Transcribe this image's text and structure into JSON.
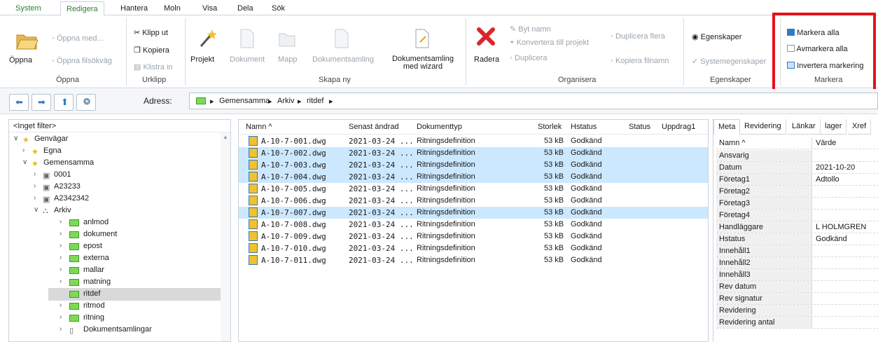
{
  "tabs": [
    "System",
    "Redigera",
    "Hantera",
    "Moln",
    "Visa",
    "Dela",
    "Sök"
  ],
  "ribbon": {
    "oppna": {
      "open": "Öppna",
      "open_with": "Öppna med...",
      "open_path": "Öppna filsökväg",
      "label": "Öppna"
    },
    "urklipp": {
      "cut": "Klipp ut",
      "copy": "Kopiera",
      "paste": "Klistra in",
      "label": "Urklipp"
    },
    "skapa": {
      "project": "Projekt",
      "document": "Dokument",
      "folder": "Mapp",
      "collection": "Dokumentsamling",
      "wizard": "Dokumentsamling med wizard",
      "label": "Skapa ny"
    },
    "organisera": {
      "delete": "Radera",
      "rename": "Byt namn",
      "convert": "Konvertera till projekt",
      "duplicate": "Duplicera",
      "duplicate_many": "Duplicera flera",
      "copy_names": "Kopiera filnamn",
      "label": "Organisera"
    },
    "egenskaper": {
      "props": "Egenskaper",
      "sysprops": "Systemegenskaper",
      "label": "Egenskaper"
    },
    "markera": {
      "select_all": "Markera alla",
      "deselect_all": "Avmarkera alla",
      "invert": "Invertera markering",
      "label": "Markera"
    }
  },
  "address": {
    "label": "Adress:",
    "crumbs": [
      "Gemensamma",
      "Arkiv",
      "ritdef"
    ]
  },
  "tree": {
    "filter": "<Inget filter>",
    "nodes": [
      "Genvägar",
      "Egna",
      "Gemensamma",
      "0001",
      "A23233",
      "A2342342",
      "Arkiv",
      "anlmod",
      "dokument",
      "epost",
      "externa",
      "mallar",
      "matning",
      "ritdef",
      "ritmod",
      "ritning",
      "Dokumentsamlingar"
    ]
  },
  "files": {
    "columns": [
      "Namn",
      "Senast ändrad",
      "Dokumenttyp",
      "Storlek",
      "Hstatus",
      "Status",
      "Uppdrag1"
    ],
    "rows": [
      {
        "name": "A-10-7-001.dwg",
        "date": "2021-03-24 ...",
        "type": "Ritningsdefinition",
        "size": "53 kB",
        "hstatus": "Godkänd",
        "selected": false
      },
      {
        "name": "A-10-7-002.dwg",
        "date": "2021-03-24 ...",
        "type": "Ritningsdefinition",
        "size": "53 kB",
        "hstatus": "Godkänd",
        "selected": true
      },
      {
        "name": "A-10-7-003.dwg",
        "date": "2021-03-24 ...",
        "type": "Ritningsdefinition",
        "size": "53 kB",
        "hstatus": "Godkänd",
        "selected": true
      },
      {
        "name": "A-10-7-004.dwg",
        "date": "2021-03-24 ...",
        "type": "Ritningsdefinition",
        "size": "53 kB",
        "hstatus": "Godkänd",
        "selected": true
      },
      {
        "name": "A-10-7-005.dwg",
        "date": "2021-03-24 ...",
        "type": "Ritningsdefinition",
        "size": "53 kB",
        "hstatus": "Godkänd",
        "selected": false
      },
      {
        "name": "A-10-7-006.dwg",
        "date": "2021-03-24 ...",
        "type": "Ritningsdefinition",
        "size": "53 kB",
        "hstatus": "Godkänd",
        "selected": false
      },
      {
        "name": "A-10-7-007.dwg",
        "date": "2021-03-24 ...",
        "type": "Ritningsdefinition",
        "size": "53 kB",
        "hstatus": "Godkänd",
        "selected": true
      },
      {
        "name": "A-10-7-008.dwg",
        "date": "2021-03-24 ...",
        "type": "Ritningsdefinition",
        "size": "53 kB",
        "hstatus": "Godkänd",
        "selected": false
      },
      {
        "name": "A-10-7-009.dwg",
        "date": "2021-03-24 ...",
        "type": "Ritningsdefinition",
        "size": "53 kB",
        "hstatus": "Godkänd",
        "selected": false
      },
      {
        "name": "A-10-7-010.dwg",
        "date": "2021-03-24 ...",
        "type": "Ritningsdefinition",
        "size": "53 kB",
        "hstatus": "Godkänd",
        "selected": false
      },
      {
        "name": "A-10-7-011.dwg",
        "date": "2021-03-24 ...",
        "type": "Ritningsdefinition",
        "size": "53 kB",
        "hstatus": "Godkänd",
        "selected": false
      }
    ]
  },
  "meta": {
    "tabs": [
      "Meta",
      "Revidering",
      "Länkar",
      "lager",
      "Xref"
    ],
    "col_name": "Namn",
    "col_value": "Värde",
    "rows": [
      {
        "k": "Ansvarig",
        "v": ""
      },
      {
        "k": "Datum",
        "v": "2021-10-20"
      },
      {
        "k": "Företag1",
        "v": "Adtollo"
      },
      {
        "k": "Företag2",
        "v": ""
      },
      {
        "k": "Företag3",
        "v": ""
      },
      {
        "k": "Företag4",
        "v": ""
      },
      {
        "k": "Handläggare",
        "v": "L HOLMGREN"
      },
      {
        "k": "Hstatus",
        "v": "Godkänd"
      },
      {
        "k": "Innehåll1",
        "v": ""
      },
      {
        "k": "Innehåll2",
        "v": ""
      },
      {
        "k": "Innehåll3",
        "v": ""
      },
      {
        "k": "Rev datum",
        "v": ""
      },
      {
        "k": "Rev signatur",
        "v": ""
      },
      {
        "k": "Revidering",
        "v": ""
      },
      {
        "k": "Revidering antal",
        "v": ""
      }
    ]
  },
  "colors": {
    "accent": "#2e7d32",
    "selection": "#cce8ff",
    "highlight": "#e3121b"
  }
}
